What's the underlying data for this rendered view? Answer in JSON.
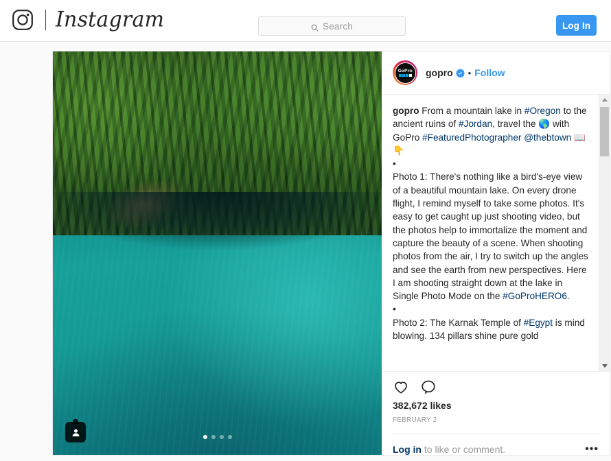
{
  "navbar": {
    "logo_icon": "instagram-camera-icon",
    "wordmark": "Instagram",
    "search": {
      "icon": "search-icon",
      "placeholder": "Search",
      "value": ""
    },
    "login_button": "Log In"
  },
  "colors": {
    "accent_blue": "#3897f0",
    "link_dark_blue": "#00376b",
    "text": "#262626",
    "muted": "#999999",
    "verified_blue": "#3897f0",
    "page_bg": "#fafafa",
    "water_teal": "#16a09a",
    "forest_green": "#2f5f1f"
  },
  "post": {
    "media": {
      "description": "Aerial drone photo of a turquoise mountain lake bordered by dense pine forest",
      "tag_badge_icon": "person-tag-icon",
      "carousel": {
        "total": 4,
        "active_index": 0
      }
    },
    "header": {
      "avatar_icon": "gopro-avatar",
      "avatar_label": "GoPro",
      "username": "gopro",
      "verified_icon": "verified-badge-icon",
      "separator": "•",
      "follow_label": "Follow"
    },
    "caption": {
      "author": "gopro",
      "intro_parts": [
        {
          "t": "text",
          "v": " From a mountain lake in "
        },
        {
          "t": "link",
          "v": "#Oregon"
        },
        {
          "t": "text",
          "v": " to the ancient ruins of "
        },
        {
          "t": "link",
          "v": "#Jordan"
        },
        {
          "t": "text",
          "v": ", travel the 🌎 with GoPro "
        },
        {
          "t": "link",
          "v": "#FeaturedPhotographer"
        },
        {
          "t": "text",
          "v": " "
        },
        {
          "t": "link",
          "v": "@thebtown"
        },
        {
          "t": "text",
          "v": " 📖👇"
        }
      ],
      "bullet": "•",
      "photo1_pre": "Photo 1: There's nothing like a bird's-eye view of a beautiful mountain lake. On every drone flight, I remind myself to take some photos. It's easy to get caught up just shooting video, but the photos help to immortalize the moment and capture the beauty of a scene. When shooting photos from the air, I try to switch up the angles and see the earth from new perspectives. Here I am shooting straight down at the lake in Single Photo Mode on the ",
      "photo1_tag": "#GoProHERO6",
      "photo1_post": ".",
      "photo2_pre": "Photo 2: The Karnak Temple of ",
      "photo2_tag": "#Egypt",
      "photo2_post": " is mind blowing. 134 pillars shine pure gold"
    },
    "actions": {
      "like_icon": "heart-icon",
      "comment_icon": "comment-bubble-icon",
      "likes": "382,672 likes",
      "date": "FEBRUARY 2",
      "login_link": "Log in",
      "login_rest": " to like or comment.",
      "more_icon": "ellipsis-icon",
      "more_glyph": "•••"
    },
    "scrollbar": {
      "up_icon": "scroll-up-arrow-icon",
      "down_icon": "scroll-down-arrow-icon",
      "thumb": "scroll-thumb"
    }
  }
}
